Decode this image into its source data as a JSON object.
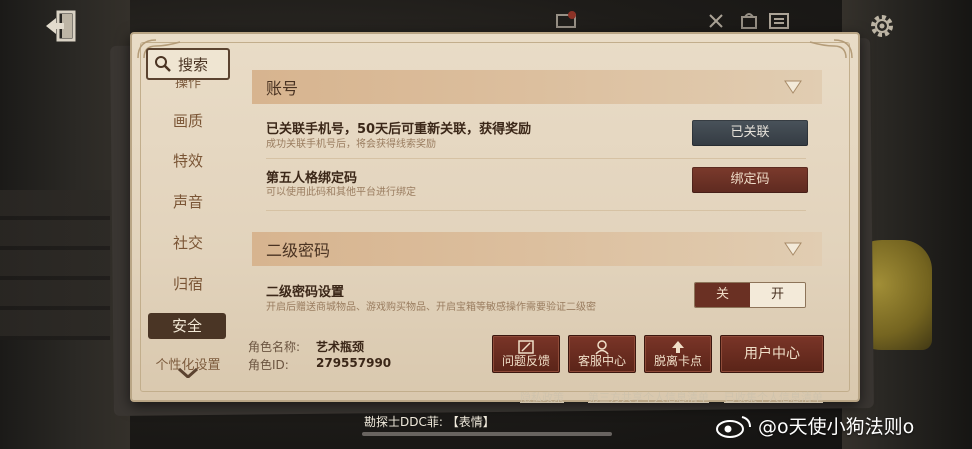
{
  "nav": {
    "search_label": "搜索",
    "top_cut_label": "操作",
    "items": [
      "画质",
      "特效",
      "声音",
      "社交",
      "归宿",
      "安全"
    ],
    "bottom_cut_label": "个性化设置",
    "active_index": 5
  },
  "sections": {
    "account": {
      "title": "账号",
      "rows": [
        {
          "title": "已关联手机号，50天后可重新关联，获得奖励",
          "subtitle": "成功关联手机号后，将会获得线索奖励",
          "button": "已关联"
        },
        {
          "title": "第五人格绑定码",
          "subtitle": "可以使用此码和其他平台进行绑定",
          "button": "绑定码"
        }
      ]
    },
    "secondary_password": {
      "title": "二级密码",
      "row": {
        "title": "二级密码设置",
        "subtitle": "开启后赠送商城物品、游戏购买物品、开启宝箱等敏感操作需要验证二级密",
        "toggle_off": "关",
        "toggle_on": "开",
        "selected": "关"
      }
    }
  },
  "footer": {
    "role_name_label": "角色名称:",
    "role_name_value": "艺术瓶颈",
    "role_id_label": "角色ID:",
    "role_id_value": "279557990",
    "buttons": {
      "feedback": "问题反馈",
      "service": "客服中心",
      "unstuck": "脱离卡点",
      "user_center": "用户中心"
    }
  },
  "bottom_links": {
    "privacy": "隐私政策",
    "third_party": "第三方共享个人信息清单",
    "collected": "已收集个人信息清单"
  },
  "chat_message": "勘探士DDC菲: 【表情】",
  "watermark": "@o天使小狗法则o",
  "colors": {
    "panel_bg": "#e9dcc7",
    "section_header": "#d7b48f",
    "accent_red": "#6a3023",
    "linked_button": "#3f474e",
    "nav_active": "#4a3525"
  }
}
